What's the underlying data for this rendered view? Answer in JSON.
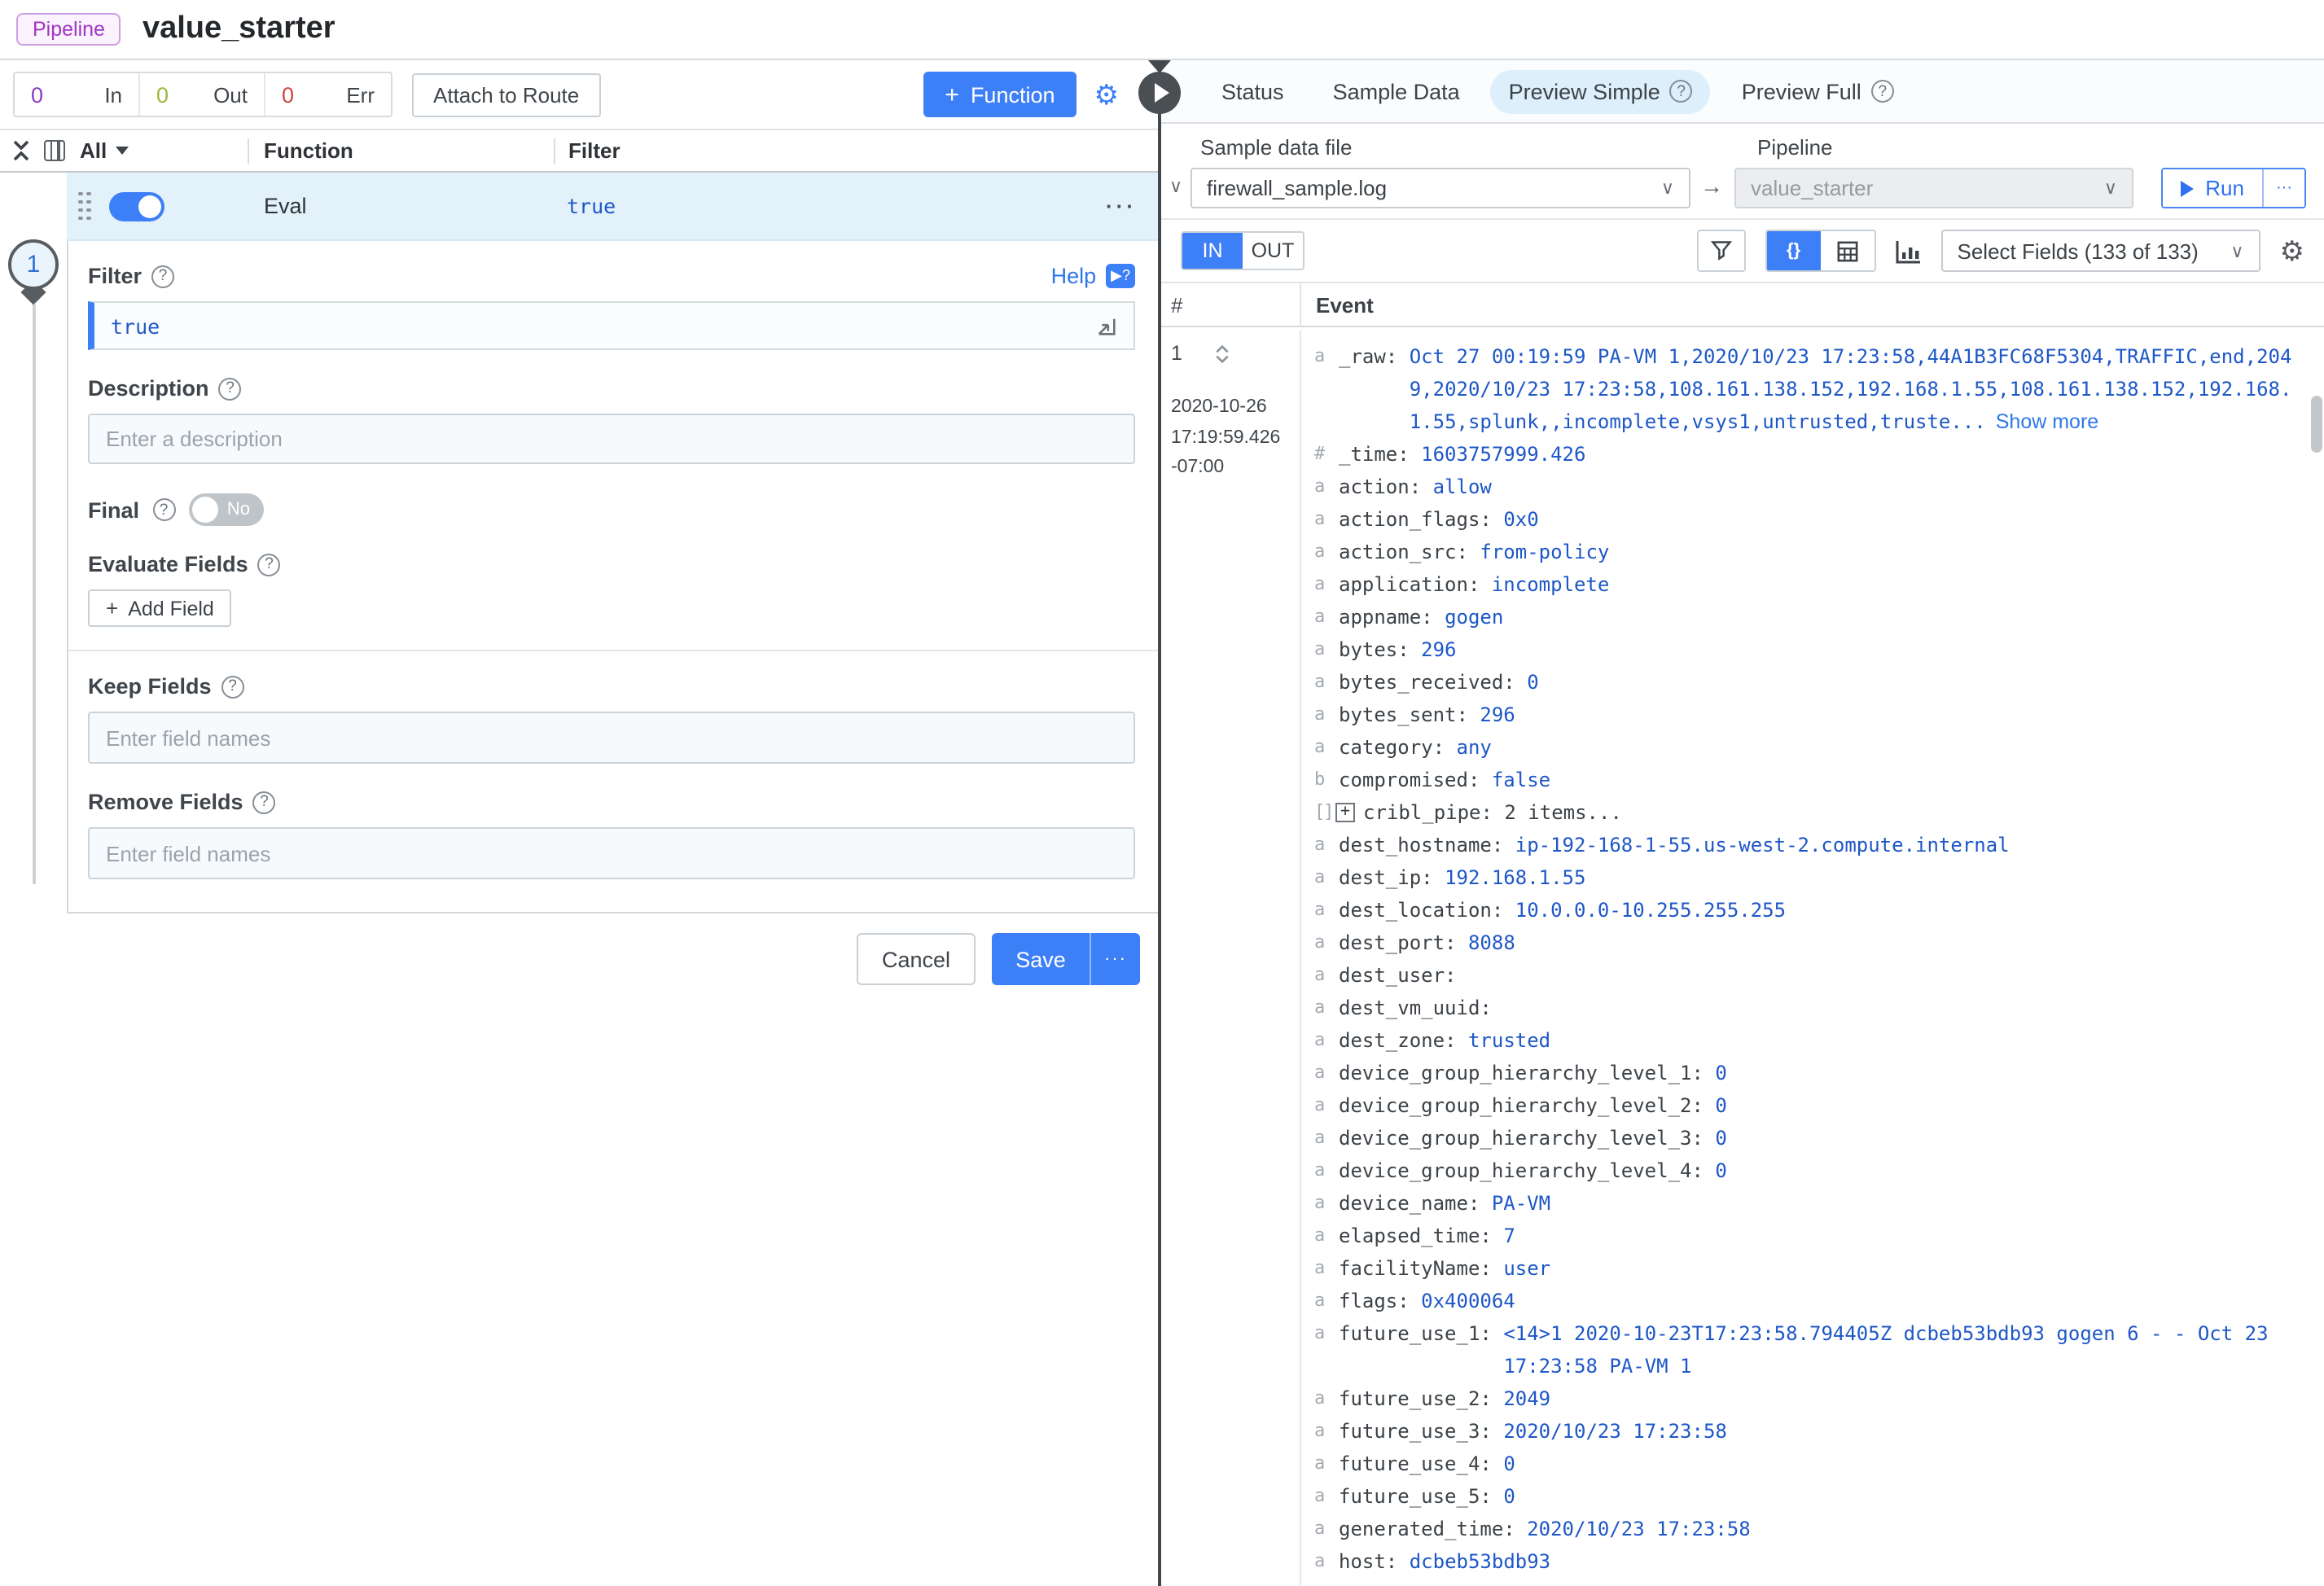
{
  "header": {
    "badge": "Pipeline",
    "title": "value_starter"
  },
  "colors": {
    "accent": "#3d7ff7",
    "value_blue": "#1e57c7",
    "in_count": "#8a3cc4",
    "out_count": "#9ab93d",
    "err_count": "#d0453c",
    "row_highlight": "#e3f1fb"
  },
  "toolbar": {
    "stats": [
      {
        "value": "0",
        "label": "In",
        "color": "#8a3cc4"
      },
      {
        "value": "0",
        "label": "Out",
        "color": "#9ab93d"
      },
      {
        "value": "0",
        "label": "Err",
        "color": "#d0453c"
      }
    ],
    "attach_label": "Attach to Route",
    "function_label": "Function",
    "function_plus": "+"
  },
  "function_table": {
    "all_label": "All",
    "col_function": "Function",
    "col_filter": "Filter",
    "row": {
      "index": "1",
      "name": "Eval",
      "filter": "true",
      "menu": "···"
    }
  },
  "editor": {
    "filter_label": "Filter",
    "help_label": "Help",
    "help_badge": "▶?",
    "filter_value": "true",
    "description_label": "Description",
    "description_placeholder": "Enter a description",
    "final_label": "Final",
    "final_value": "No",
    "evaluate_label": "Evaluate Fields",
    "add_field_label": "Add Field",
    "add_field_plus": "+",
    "keep_label": "Keep Fields",
    "keep_placeholder": "Enter field names",
    "remove_label": "Remove Fields",
    "remove_placeholder": "Enter field names",
    "cancel_label": "Cancel",
    "save_label": "Save",
    "save_more": "···",
    "qmark": "?"
  },
  "preview": {
    "tabs": [
      {
        "label": "Status",
        "active": false,
        "help": false
      },
      {
        "label": "Sample Data",
        "active": false,
        "help": false
      },
      {
        "label": "Preview Simple",
        "active": true,
        "help": true
      },
      {
        "label": "Preview Full",
        "active": false,
        "help": true
      }
    ],
    "sample_label": "Sample data file",
    "sample_value": "firewall_sample.log",
    "pipeline_label": "Pipeline",
    "pipeline_value": "value_starter",
    "flow_arrow": "→",
    "run_label": "Run",
    "run_more": "···",
    "in_label": "IN",
    "out_label": "OUT",
    "braces_icon": "{}",
    "select_fields": "Select Fields (133 of 133)",
    "col_num": "#",
    "col_event": "Event",
    "chevron": "∨"
  },
  "event": {
    "num": "1",
    "date": "2020-10-26",
    "time": "17:19:59.426",
    "tz": "-07:00",
    "raw": {
      "t": "a",
      "n": "_raw",
      "v": "Oct 27 00:19:59 PA-VM 1,2020/10/23 17:23:58,44A1B3FC68F5304,TRAFFIC,end,2049,2020/10/23 17:23:58,108.161.138.152,192.168.1.55,108.161.138.152,192.168.1.55,splunk,,incomplete,vsys1,untrusted,truste...",
      "show_more": "Show more"
    },
    "fields": [
      {
        "t": "#",
        "n": "_time",
        "v": "1603757999.426"
      },
      {
        "t": "a",
        "n": "action",
        "v": "allow"
      },
      {
        "t": "a",
        "n": "action_flags",
        "v": "0x0"
      },
      {
        "t": "a",
        "n": "action_src",
        "v": "from-policy"
      },
      {
        "t": "a",
        "n": "application",
        "v": "incomplete"
      },
      {
        "t": "a",
        "n": "appname",
        "v": "gogen"
      },
      {
        "t": "a",
        "n": "bytes",
        "v": "296"
      },
      {
        "t": "a",
        "n": "bytes_received",
        "v": "0"
      },
      {
        "t": "a",
        "n": "bytes_sent",
        "v": "296"
      },
      {
        "t": "a",
        "n": "category",
        "v": "any"
      },
      {
        "t": "b",
        "n": "compromised",
        "v": "false"
      },
      {
        "t": "[]",
        "n": "cribl_pipe",
        "v": "2 items...",
        "expand": true,
        "dark": true
      },
      {
        "t": "a",
        "n": "dest_hostname",
        "v": "ip-192-168-1-55.us-west-2.compute.internal"
      },
      {
        "t": "a",
        "n": "dest_ip",
        "v": "192.168.1.55"
      },
      {
        "t": "a",
        "n": "dest_location",
        "v": "10.0.0.0-10.255.255.255"
      },
      {
        "t": "a",
        "n": "dest_port",
        "v": "8088"
      },
      {
        "t": "a",
        "n": "dest_user",
        "v": ""
      },
      {
        "t": "a",
        "n": "dest_vm_uuid",
        "v": ""
      },
      {
        "t": "a",
        "n": "dest_zone",
        "v": "trusted"
      },
      {
        "t": "a",
        "n": "device_group_hierarchy_level_1",
        "v": "0"
      },
      {
        "t": "a",
        "n": "device_group_hierarchy_level_2",
        "v": "0"
      },
      {
        "t": "a",
        "n": "device_group_hierarchy_level_3",
        "v": "0"
      },
      {
        "t": "a",
        "n": "device_group_hierarchy_level_4",
        "v": "0"
      },
      {
        "t": "a",
        "n": "device_name",
        "v": "PA-VM"
      },
      {
        "t": "a",
        "n": "elapsed_time",
        "v": "7"
      },
      {
        "t": "a",
        "n": "facilityName",
        "v": "user"
      },
      {
        "t": "a",
        "n": "flags",
        "v": "0x400064"
      },
      {
        "t": "a",
        "n": "future_use_1",
        "v": "<14>1 2020-10-23T17:23:58.794405Z dcbeb53bdb93 gogen 6 - - Oct 23 17:23:58 PA-VM 1"
      },
      {
        "t": "a",
        "n": "future_use_2",
        "v": "2049"
      },
      {
        "t": "a",
        "n": "future_use_3",
        "v": "2020/10/23 17:23:58"
      },
      {
        "t": "a",
        "n": "future_use_4",
        "v": "0"
      },
      {
        "t": "a",
        "n": "future_use_5",
        "v": "0"
      },
      {
        "t": "a",
        "n": "generated_time",
        "v": "2020/10/23 17:23:58"
      },
      {
        "t": "a",
        "n": "host",
        "v": "dcbeb53bdb93"
      }
    ]
  }
}
